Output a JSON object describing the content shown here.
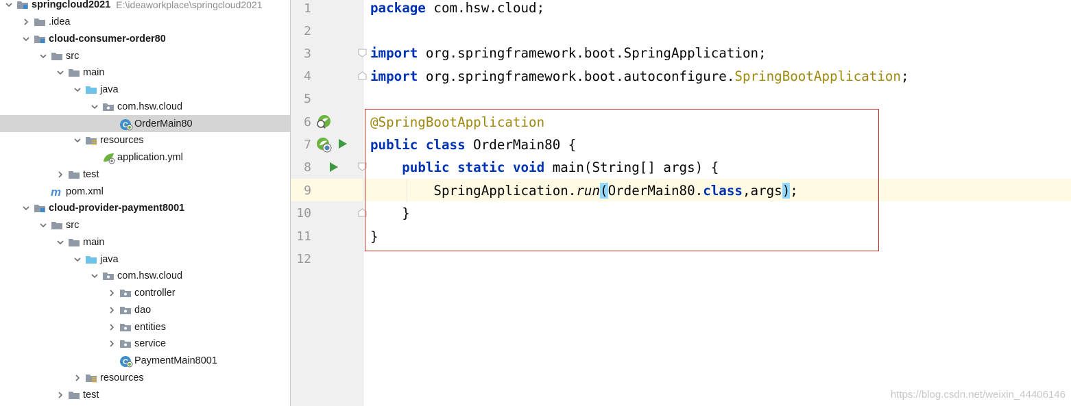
{
  "project_tree": {
    "items": [
      {
        "label": "springcloud2021",
        "path": "E:\\ideaworkplace\\springcloud2021",
        "icon": "module-folder-icon",
        "expanded": true
      },
      {
        "label": ".idea",
        "icon": "folder-icon",
        "expanded": false
      },
      {
        "label": "cloud-consumer-order80",
        "icon": "module-folder-icon",
        "expanded": true
      },
      {
        "label": "src",
        "icon": "folder-icon",
        "expanded": true
      },
      {
        "label": "main",
        "icon": "folder-icon",
        "expanded": true
      },
      {
        "label": "java",
        "icon": "source-folder-icon",
        "expanded": true
      },
      {
        "label": "com.hsw.cloud",
        "icon": "package-icon",
        "expanded": true
      },
      {
        "label": "OrderMain80",
        "icon": "spring-boot-class-icon",
        "selected": true
      },
      {
        "label": "resources",
        "icon": "resources-folder-icon",
        "expanded": true
      },
      {
        "label": "application.yml",
        "icon": "spring-config-icon"
      },
      {
        "label": "test",
        "icon": "folder-icon",
        "expanded": false
      },
      {
        "label": "pom.xml",
        "icon": "maven-icon"
      },
      {
        "label": "cloud-provider-payment8001",
        "icon": "module-folder-icon",
        "expanded": true
      },
      {
        "label": "src",
        "icon": "folder-icon",
        "expanded": true
      },
      {
        "label": "main",
        "icon": "folder-icon",
        "expanded": true
      },
      {
        "label": "java",
        "icon": "source-folder-icon",
        "expanded": true
      },
      {
        "label": "com.hsw.cloud",
        "icon": "package-icon",
        "expanded": true
      },
      {
        "label": "controller",
        "icon": "package-icon",
        "expanded": false
      },
      {
        "label": "dao",
        "icon": "package-icon",
        "expanded": false
      },
      {
        "label": "entities",
        "icon": "package-icon",
        "expanded": false
      },
      {
        "label": "service",
        "icon": "package-icon",
        "expanded": false
      },
      {
        "label": "PaymentMain8001",
        "icon": "spring-boot-class-icon"
      },
      {
        "label": "resources",
        "icon": "resources-folder-icon",
        "expanded": false
      },
      {
        "label": "test",
        "icon": "folder-icon",
        "expanded": false
      }
    ]
  },
  "editor": {
    "line_numbers": [
      "1",
      "2",
      "3",
      "4",
      "5",
      "6",
      "7",
      "8",
      "9",
      "10",
      "11",
      "12"
    ],
    "code": {
      "l1_kw": "package",
      "l1_rest": " com.hsw.cloud;",
      "l3_kw": "import",
      "l3_rest": " org.springframework.boot.SpringApplication;",
      "l4_kw": "import",
      "l4_rest": " org.springframework.boot.autoconfigure.",
      "l4_ann": "SpringBootApplication",
      "l4_end": ";",
      "l6_ann": "@SpringBootApplication",
      "l7_kw": "public class",
      "l7_rest": " OrderMain80 {",
      "l8_indent": "    ",
      "l8_kw": "public static void",
      "l8_rest": " main(String[] args) {",
      "l9_indent": "        ",
      "l9_a": "SpringApplication.",
      "l9_run": "run",
      "l9_open": "(",
      "l9_b": "OrderMain80.",
      "l9_kw": "class",
      "l9_c": ",args",
      "l9_close": ")",
      "l9_end": ";",
      "l10": "    }",
      "l11": "}"
    },
    "colors": {
      "keyword": "#0033b3",
      "annotation": "#9e880d",
      "caret_line": "#fefae3",
      "highlight_box": "#d22b2b"
    }
  },
  "watermark": "https://blog.csdn.net/weixin_44406146"
}
